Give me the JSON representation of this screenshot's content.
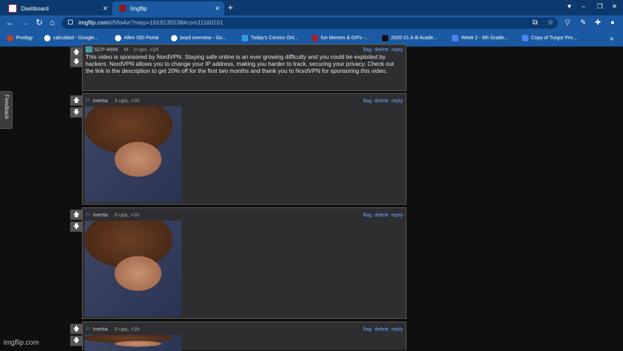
{
  "browser": {
    "tabs": [
      {
        "title": "Dashboard",
        "close": "✕"
      },
      {
        "title": "Imgflip",
        "close": "✕"
      }
    ],
    "new_tab": "+",
    "url_host": "imgflip.com",
    "url_path": "/i/56s4vr?nerp=1619135538#com11160101",
    "bookmarks": [
      {
        "label": "Prodigy",
        "color": "#c4412a"
      },
      {
        "label": "calculatot - Google...",
        "color": "#ffffff"
      },
      {
        "label": "Allen ISD Portal",
        "color": "#ffffff"
      },
      {
        "label": "boyd overview - Go...",
        "color": "#ffffff"
      },
      {
        "label": "Today's Comics Onl...",
        "color": "#2f9de0"
      },
      {
        "label": "fun Memes & GIFs -...",
        "color": "#a0222a"
      },
      {
        "label": "2020-21 A-B Acade...",
        "color": "#111111"
      },
      {
        "label": "Week 2 - 6th Grade...",
        "color": "#4b84f0"
      },
      {
        "label": "Copy of Turgor Pre...",
        "color": "#4b84f0"
      }
    ],
    "more_bookmarks": "»"
  },
  "feedback_label": "Feedback",
  "comments": [
    {
      "user": "SCP-4666",
      "flag_letter": "M",
      "meta": "0 ups, <1h",
      "actions": [
        "flag",
        "delete",
        "reply"
      ],
      "text": "This video is sponsored by NordVPN. Staying safe online is an ever growing difficulty and you could be exploited by hackers. NordVPN allows you to change your IP address, making you harder to track, securing your privacy. Check out the link in the description to get 20% off for the first two months and thank you to NordVPN for sponsoring this video."
    },
    {
      "user": "Inertia.",
      "meta": "0 ups, <1h",
      "actions": [
        "flag",
        "delete",
        "reply"
      ]
    },
    {
      "user": "Inertia.",
      "meta": "0 ups, <1h",
      "actions": [
        "flag",
        "delete",
        "reply"
      ]
    },
    {
      "user": "Inertia.",
      "meta": "0 ups, <1h",
      "actions": [
        "flag",
        "delete",
        "reply"
      ]
    }
  ],
  "watermark": "imgflip.com"
}
